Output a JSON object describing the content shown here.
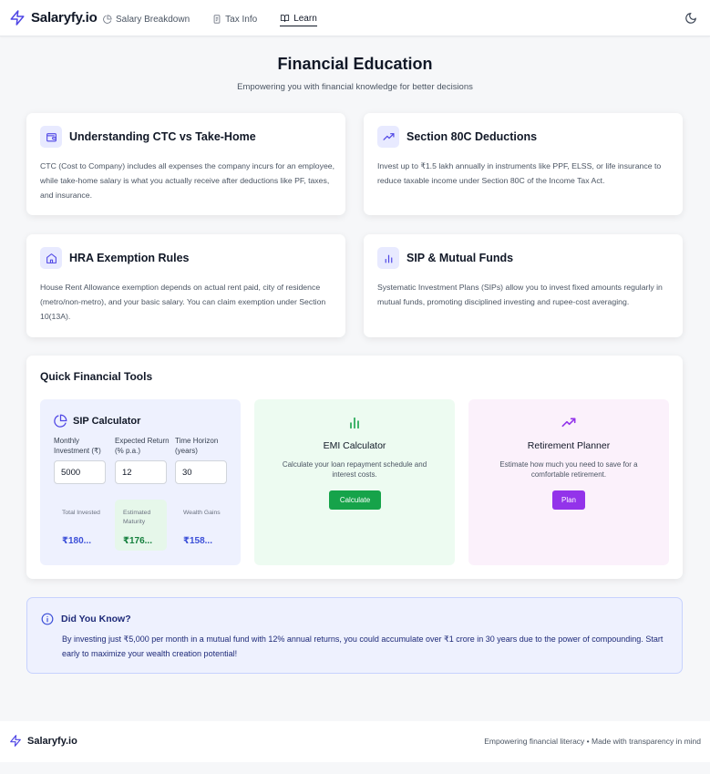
{
  "header": {
    "brand": "Salaryfy.io",
    "nav": [
      {
        "label": "Salary Breakdown",
        "icon": "pie-chart-icon"
      },
      {
        "label": "Tax Info",
        "icon": "document-icon"
      },
      {
        "label": "Learn",
        "icon": "book-icon",
        "active": true
      }
    ],
    "theme_toggle_icon": "moon-icon"
  },
  "hero": {
    "title": "Financial Education",
    "subtitle": "Empowering you with financial knowledge for better decisions"
  },
  "cards": [
    {
      "title": "Understanding CTC vs Take-Home",
      "icon": "wallet-icon",
      "body": "CTC (Cost to Company) includes all expenses the company incurs for an employee, while take-home salary is what you actually receive after deductions like PF, taxes, and insurance."
    },
    {
      "title": "Section 80C Deductions",
      "icon": "trending-up-icon",
      "body": "Invest up to ₹1.5 lakh annually in instruments like PPF, ELSS, or life insurance to reduce taxable income under Section 80C of the Income Tax Act."
    },
    {
      "title": "HRA Exemption Rules",
      "icon": "home-icon",
      "body": "House Rent Allowance exemption depends on actual rent paid, city of residence (metro/non-metro), and your basic salary. You can claim exemption under Section 10(13A)."
    },
    {
      "title": "SIP & Mutual Funds",
      "icon": "bar-chart-icon",
      "body": "Systematic Investment Plans (SIPs) allow you to invest fixed amounts regularly in mutual funds, promoting disciplined investing and rupee-cost averaging."
    }
  ],
  "tools": {
    "title": "Quick Financial Tools",
    "sip": {
      "title": "SIP Calculator",
      "fields": [
        {
          "label": "Monthly Investment (₹)",
          "value": "5000"
        },
        {
          "label": "Expected Return (% p.a.)",
          "value": "12"
        },
        {
          "label": "Time Horizon (years)",
          "value": "30"
        }
      ],
      "stats": [
        {
          "label": "Total Invested",
          "value": "₹180..."
        },
        {
          "label": "Estimated Maturity",
          "value": "₹176..."
        },
        {
          "label": "Wealth Gains",
          "value": "₹158..."
        }
      ]
    },
    "emi": {
      "title": "EMI Calculator",
      "desc": "Calculate your loan repayment schedule and interest costs.",
      "button": "Calculate"
    },
    "retirement": {
      "title": "Retirement Planner",
      "desc": "Estimate how much you need to save for a comfortable retirement.",
      "button": "Plan"
    }
  },
  "did_you_know": {
    "title": "Did You Know?",
    "text": "By investing just ₹5,000 per month in a mutual fund with 12% annual returns, you could accumulate over ₹1 crore in 30 years due to the power of compounding. Start early to maximize your wealth creation potential!"
  },
  "footer": {
    "brand": "Salaryfy.io",
    "tagline": "Empowering financial literacy • Made with transparency in mind"
  },
  "colors": {
    "brand": "#4f46e5",
    "emi_button": "#16a34a",
    "plan_button": "#9333ea",
    "stat_blue": "#3b4fd8",
    "stat_green": "#15803d"
  }
}
